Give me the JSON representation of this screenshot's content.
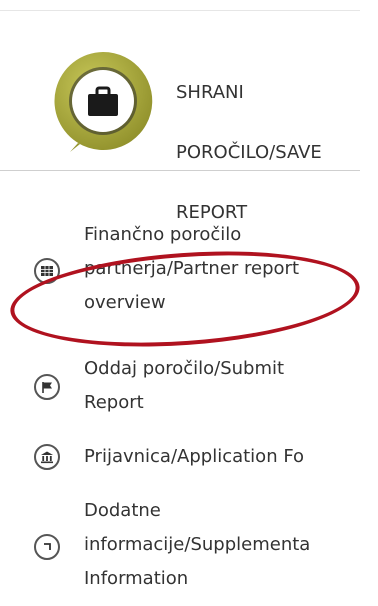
{
  "save_card": {
    "label_lines": [
      "SHRANI",
      "POROČILO/SAVE",
      "REPORT"
    ],
    "icon": "briefcase-icon",
    "badge_color": "#a9a939"
  },
  "menu": [
    {
      "lines": [
        "Finančno poročilo",
        "partnerja/Partner report",
        "overview"
      ],
      "icon": "grid-icon"
    },
    {
      "lines": [
        "Oddaj poročilo/Submit",
        "Report"
      ],
      "icon": "flag-icon"
    },
    {
      "lines": [
        "Prijavnica/Application Fo"
      ],
      "icon": "bank-icon"
    },
    {
      "lines": [
        "Dodatne",
        "informacije/Supplementa",
        "Information"
      ],
      "icon": "return-arrow-icon"
    }
  ],
  "colors": {
    "annotation_ellipse": "#b0121f",
    "text": "#333333",
    "icon_border": "#555555"
  }
}
